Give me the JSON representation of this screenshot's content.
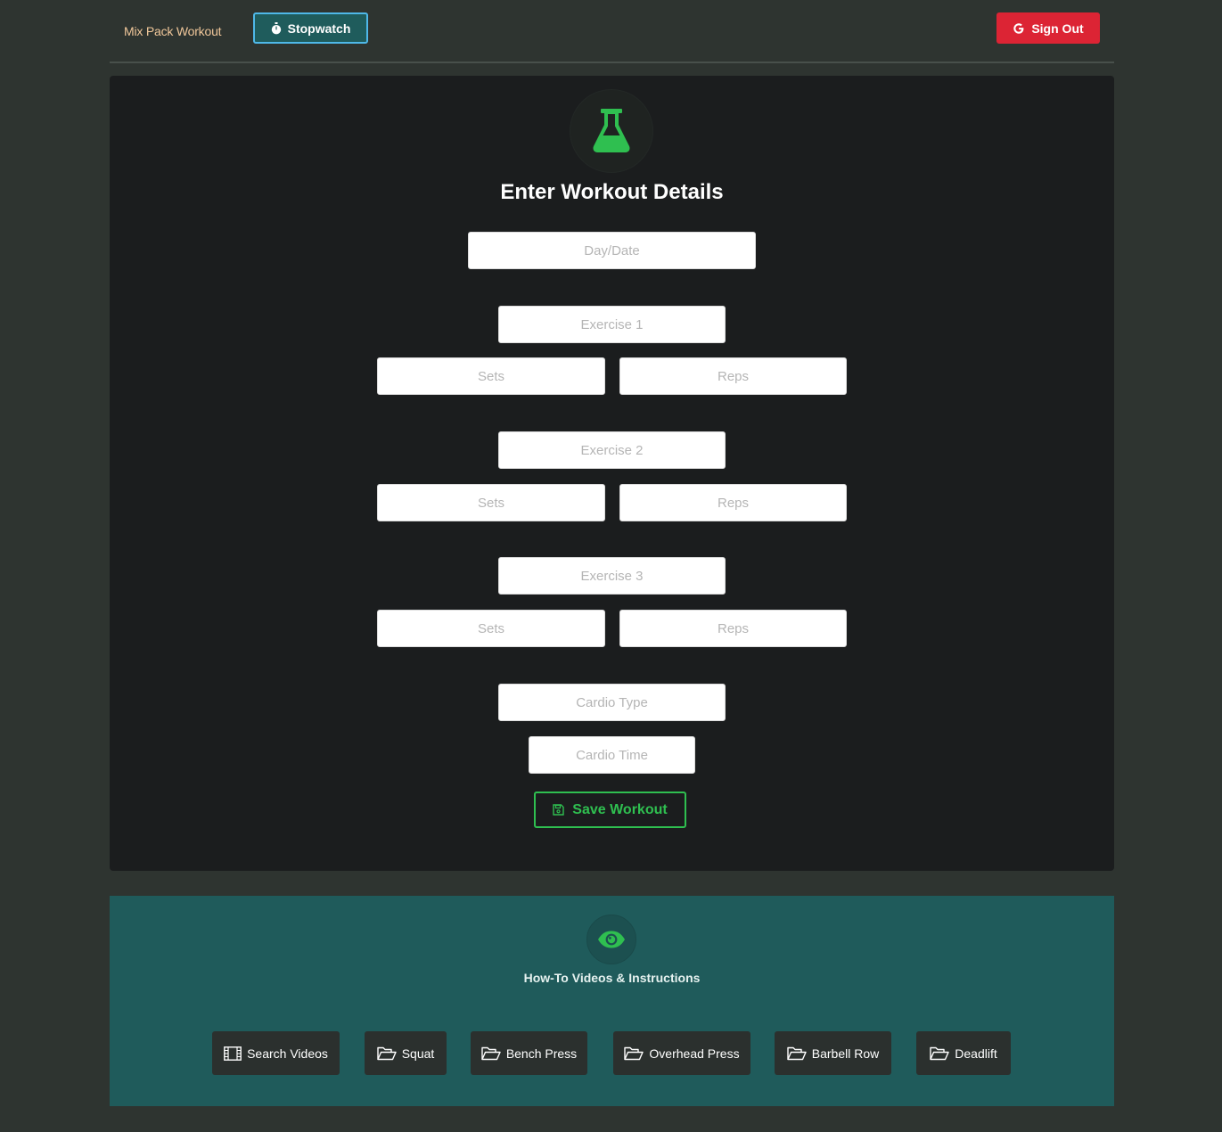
{
  "navbar": {
    "brand": "Mix Pack Workout",
    "stopwatch_label": "Stopwatch",
    "signout_label": "Sign Out",
    "stopwatch_icon": "stopwatch-icon",
    "signout_icon": "google-icon"
  },
  "form": {
    "title": "Enter Workout Details",
    "icon": "flask-icon",
    "date_placeholder": "Day/Date",
    "exercises": [
      {
        "name_placeholder": "Exercise 1",
        "sets_placeholder": "Sets",
        "reps_placeholder": "Reps"
      },
      {
        "name_placeholder": "Exercise 2",
        "sets_placeholder": "Sets",
        "reps_placeholder": "Reps"
      },
      {
        "name_placeholder": "Exercise 3",
        "sets_placeholder": "Sets",
        "reps_placeholder": "Reps"
      }
    ],
    "cardio_type_placeholder": "Cardio Type",
    "cardio_time_placeholder": "Cardio Time",
    "save_label": "Save Workout",
    "save_icon": "floppy-disk-icon"
  },
  "videos": {
    "title": "How-To Videos & Instructions",
    "icon": "eye-icon",
    "buttons": [
      {
        "label": "Search Videos",
        "icon": "film-icon"
      },
      {
        "label": "Squat",
        "icon": "folder-open-icon"
      },
      {
        "label": "Bench Press",
        "icon": "folder-open-icon"
      },
      {
        "label": "Overhead Press",
        "icon": "folder-open-icon"
      },
      {
        "label": "Barbell Row",
        "icon": "folder-open-icon"
      },
      {
        "label": "Deadlift",
        "icon": "folder-open-icon"
      }
    ]
  },
  "colors": {
    "background": "#2e3430",
    "card": "#1b1d1e",
    "accent_green": "#2fbf50",
    "teal": "#1f5b5b",
    "danger": "#dc2434",
    "info_border": "#4fb8e8",
    "brand_text": "#f0c79a"
  }
}
